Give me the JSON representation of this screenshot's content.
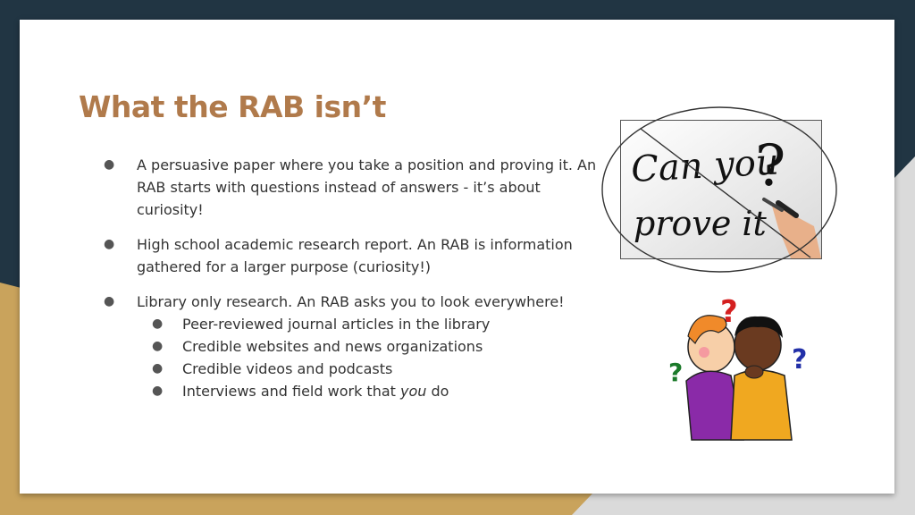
{
  "slide": {
    "title": "What the RAB isn’t",
    "bullets": [
      {
        "text": "A persuasive paper where you take a position and proving it. An RAB starts with questions instead of answers - it’s about curiosity!"
      },
      {
        "text": "High school academic research report. An RAB is information gathered for a larger purpose (curiosity!)"
      },
      {
        "text": "Library only research. An RAB asks you to look everywhere!",
        "sub": [
          "Peer-reviewed journal articles in the library",
          "Credible websites and news organizations",
          "Credible videos and podcasts"
        ],
        "last_sub": {
          "before": "Interviews and field work that ",
          "em": "you",
          "after": " do"
        }
      }
    ],
    "bullet_glyph": "●"
  },
  "images": {
    "photo": {
      "text_line1": "Can you",
      "question_mark": "?",
      "text_line2": "prove it"
    }
  },
  "colors": {
    "title": "#b07a4b",
    "background": "#213543",
    "gold": "#c9a35c",
    "body_text": "#333333"
  },
  "icons": [
    "can-you-prove-it-photo",
    "crossed-out-ellipse",
    "curious-kids-cartoon"
  ]
}
